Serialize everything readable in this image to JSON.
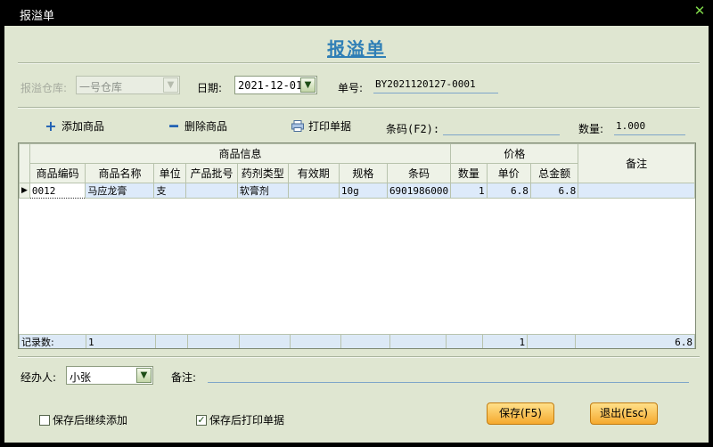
{
  "window": {
    "title": "报溢单",
    "close_glyph": "✕"
  },
  "form": {
    "heading": "报溢单",
    "warehouse_label": "报溢仓库:",
    "warehouse_value": "一号仓库",
    "date_label": "日期:",
    "date_value": "2021-12-01",
    "order_no_label": "单号:",
    "order_no_value": "BY2021120127-0001"
  },
  "toolbar": {
    "add_label": "添加商品",
    "delete_label": "删除商品",
    "print_label": "打印单据",
    "barcode_label": "条码(F2):",
    "barcode_value": "",
    "qty_label": "数量:",
    "qty_value": "1.000"
  },
  "grid": {
    "group_product": "商品信息",
    "group_price": "价格",
    "remark_header": "备注",
    "columns": [
      "商品编码",
      "商品名称",
      "单位",
      "产品批号",
      "药剂类型",
      "有效期",
      "规格",
      "条码",
      "数量",
      "单价",
      "总金额"
    ],
    "rows": [
      [
        "0012",
        "马应龙膏",
        "支",
        "",
        "软膏剂",
        "",
        "10g",
        "6901986000",
        "1",
        "6.8",
        "6.8",
        ""
      ]
    ],
    "footer": {
      "count_label": "记录数:",
      "count_value": "1",
      "qty_total": "1",
      "amount_total": "6.8"
    }
  },
  "bottom": {
    "handler_label": "经办人:",
    "handler_value": "小张",
    "remark_label": "备注:",
    "remark_value": "",
    "continue_add_label": "保存后继续添加",
    "continue_add_checked": false,
    "print_after_save_label": "保存后打印单据",
    "print_after_save_checked": true,
    "save_button": "保存(F5)",
    "exit_button": "退出(Esc)"
  },
  "icons": {
    "dropdown": "chevron-down-icon",
    "add": "plus-icon",
    "delete": "minus-icon",
    "print": "printer-icon",
    "row_indicator": "triangle-right-icon"
  },
  "colors": {
    "heading": "#2f7fb6",
    "background": "#dfe6d1",
    "button": "#f5a92e"
  }
}
